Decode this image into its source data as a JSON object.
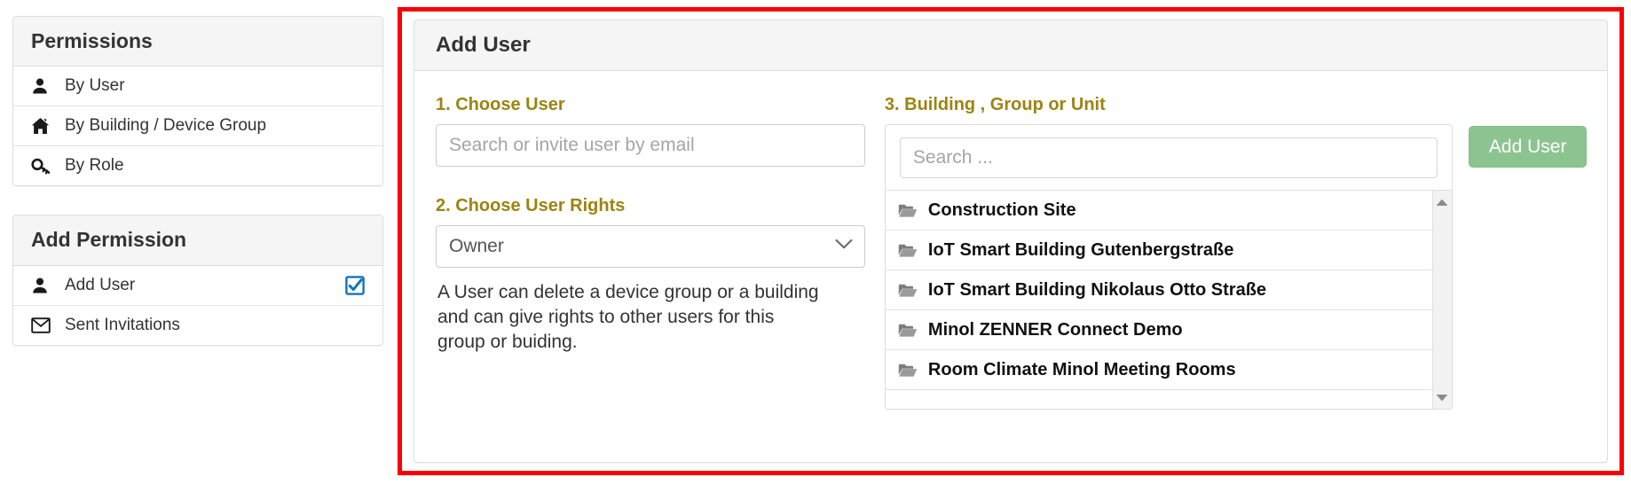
{
  "sidebar": {
    "permissions": {
      "title": "Permissions",
      "items": [
        {
          "label": "By User",
          "icon": "user-icon"
        },
        {
          "label": "By Building / Device Group",
          "icon": "home-icon"
        },
        {
          "label": "By Role",
          "icon": "key-icon"
        }
      ]
    },
    "add_permission": {
      "title": "Add Permission",
      "items": [
        {
          "label": "Add User",
          "icon": "user-icon",
          "trailing_icon": "checked-checkbox-icon",
          "selected": true
        },
        {
          "label": "Sent Invitations",
          "icon": "envelope-icon",
          "trailing_icon": "",
          "selected": false
        }
      ]
    }
  },
  "main": {
    "title": "Add User",
    "step1": {
      "label": "1. Choose User",
      "search_placeholder": "Search or invite user by email",
      "search_value": ""
    },
    "step2": {
      "label": "2. Choose User Rights",
      "selected_option": "Owner",
      "options": [
        "Owner"
      ],
      "help_text": "A User can delete a device group or a building and can give rights to other users for this group or buiding."
    },
    "step3": {
      "label": "3. Building , Group or Unit",
      "search_placeholder": "Search ...",
      "search_value": "",
      "items": [
        {
          "label": "Construction Site",
          "icon": "folder-open-icon"
        },
        {
          "label": "IoT Smart Building Gutenbergstraße",
          "icon": "folder-open-icon"
        },
        {
          "label": "IoT Smart Building Nikolaus Otto Straße",
          "icon": "folder-open-icon"
        },
        {
          "label": "Minol ZENNER Connect Demo",
          "icon": "folder-open-icon"
        },
        {
          "label": "Room Climate Minol Meeting Rooms",
          "icon": "folder-open-icon"
        }
      ],
      "scrollbar": {
        "up_arrow": "caret-up-icon",
        "down_arrow": "caret-down-icon"
      }
    },
    "submit_label": "Add User"
  },
  "colors": {
    "step_label": "#9c8411",
    "highlight_border": "#fb0000",
    "button_green": "#8cc490",
    "checkbox_blue": "#1273bd",
    "panel_header": "#f5f5f5"
  }
}
